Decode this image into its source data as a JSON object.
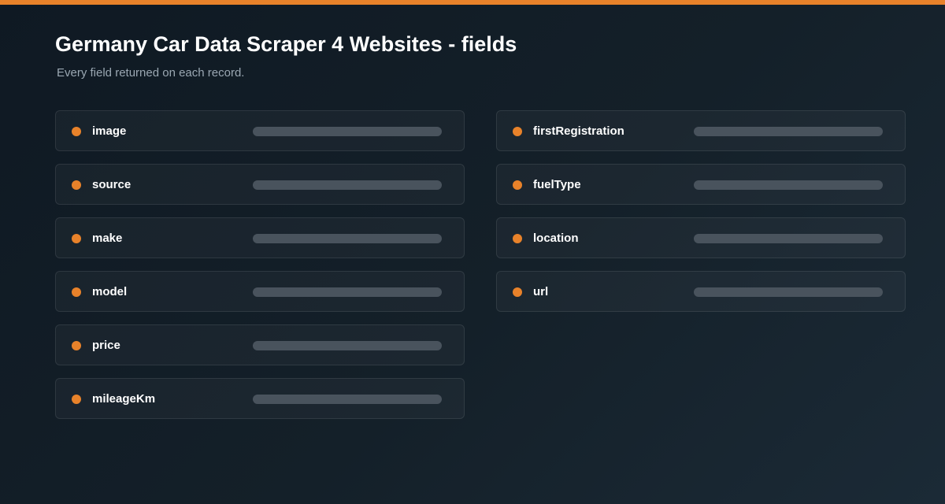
{
  "colors": {
    "accent": "#e8822a",
    "placeholder_bar": "#49535d"
  },
  "header": {
    "title": "Germany Car Data Scraper 4 Websites - fields",
    "subtitle": "Every field returned on each record."
  },
  "fields": {
    "left": [
      {
        "name": "image",
        "marker_icon": "dot-icon"
      },
      {
        "name": "source",
        "marker_icon": "dot-icon"
      },
      {
        "name": "make",
        "marker_icon": "dot-icon"
      },
      {
        "name": "model",
        "marker_icon": "dot-icon"
      },
      {
        "name": "price",
        "marker_icon": "dot-icon"
      },
      {
        "name": "mileageKm",
        "marker_icon": "dot-icon"
      }
    ],
    "right": [
      {
        "name": "firstRegistration",
        "marker_icon": "dot-icon"
      },
      {
        "name": "fuelType",
        "marker_icon": "dot-icon"
      },
      {
        "name": "location",
        "marker_icon": "dot-icon"
      },
      {
        "name": "url",
        "marker_icon": "dot-icon"
      }
    ]
  }
}
